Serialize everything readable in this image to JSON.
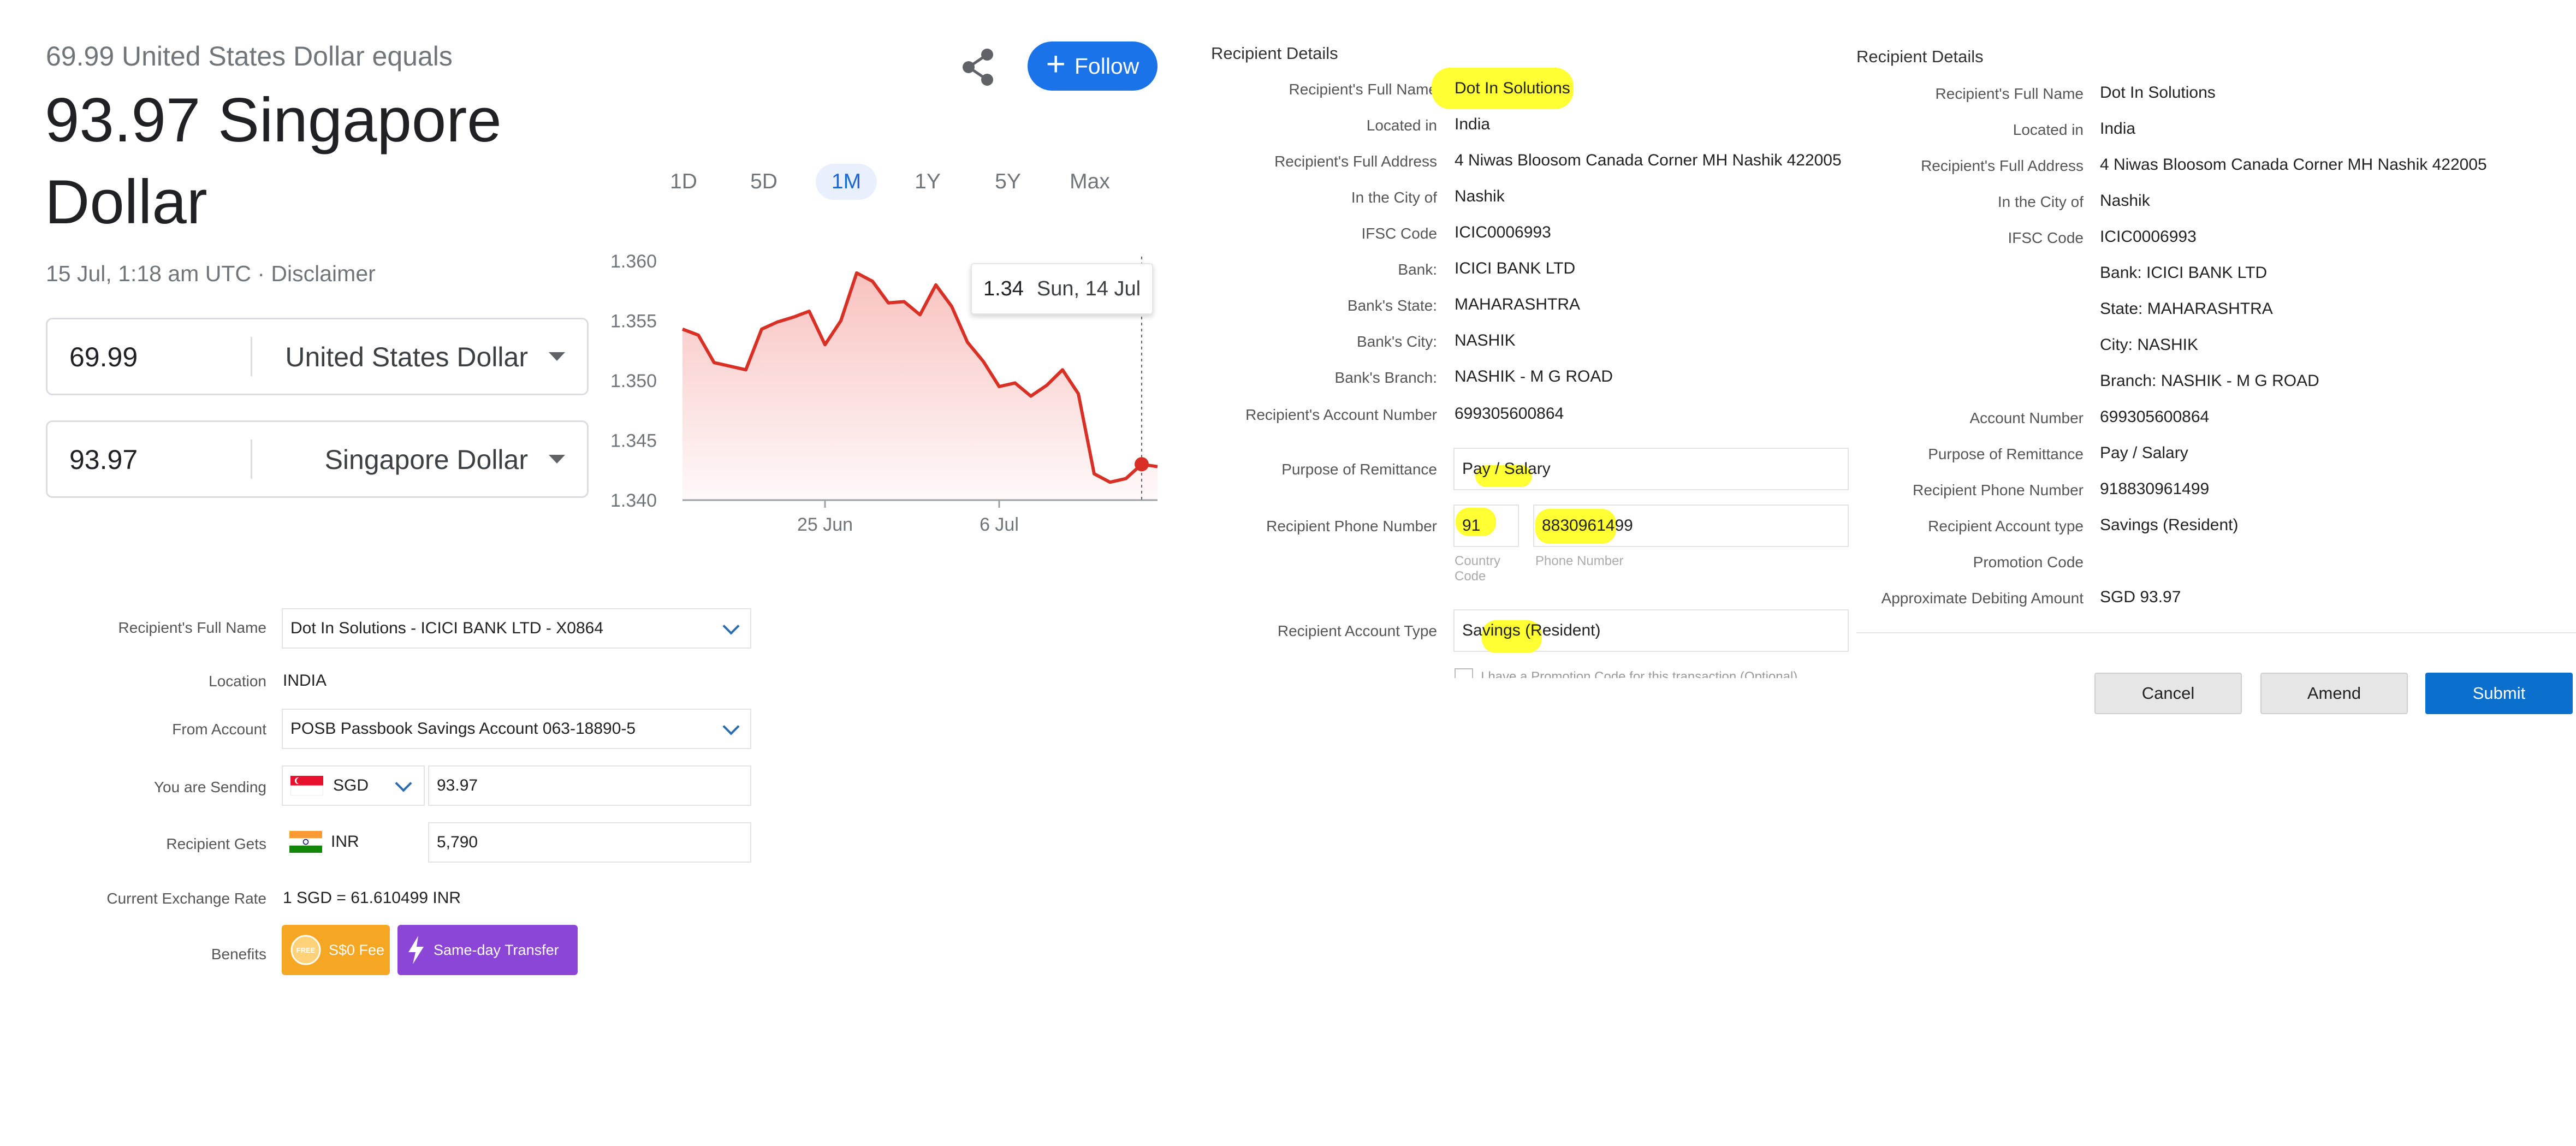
{
  "converter": {
    "equals_text": "69.99 United States Dollar equals",
    "result_line1": "93.97 Singapore",
    "result_line2": "Dollar",
    "timestamp": "15 Jul, 1:18 am UTC · Disclaimer",
    "from_amount": "69.99",
    "from_currency": "United States Dollar",
    "to_amount": "93.97",
    "to_currency": "Singapore Dollar",
    "follow_label": "Follow",
    "follow_plus": "+",
    "ranges": [
      "1D",
      "5D",
      "1M",
      "1Y",
      "5Y",
      "Max"
    ],
    "active_range": "1M",
    "tooltip_value": "1.34",
    "tooltip_date": "Sun, 14 Jul"
  },
  "chart_data": {
    "type": "area",
    "yticks": [
      "1.360",
      "1.355",
      "1.350",
      "1.345",
      "1.340"
    ],
    "xticks": [
      "25 Jun",
      "6 Jul"
    ],
    "ylim": [
      1.34,
      1.36
    ],
    "values": [
      1.3543,
      1.3538,
      1.3515,
      1.3512,
      1.3509,
      1.3543,
      1.3549,
      1.3553,
      1.3558,
      1.353,
      1.355,
      1.359,
      1.3583,
      1.3565,
      1.3566,
      1.3555,
      1.358,
      1.3562,
      1.3532,
      1.3516,
      1.3495,
      1.3498,
      1.3487,
      1.3496,
      1.3509,
      1.3489,
      1.3422,
      1.3415,
      1.3418,
      1.343,
      1.3428
    ],
    "line_color": "#d93025"
  },
  "left_form": {
    "recipient_label": "Recipient's Full Name",
    "recipient_value": "Dot In Solutions - ICICI BANK LTD - X0864",
    "location_label": "Location",
    "location_value": "INDIA",
    "from_account_label": "From Account",
    "from_account_value": "POSB Passbook Savings Account 063-18890-5",
    "sending_label": "You are Sending",
    "sending_currency": "SGD",
    "sending_amount": "93.97",
    "gets_label": "Recipient Gets",
    "gets_currency": "INR",
    "gets_amount": "5,790",
    "rate_label": "Current Exchange Rate",
    "rate_value": "1 SGD = 61.610499 INR",
    "benefits_label": "Benefits",
    "badge_fee": "S$0 Fee",
    "badge_fee_icon_text": "FREE",
    "badge_transfer": "Same-day Transfer",
    "badge_fee_color": "#f5a623",
    "badge_transfer_color": "#8b46d8"
  },
  "middle_form": {
    "header": "Recipient Details",
    "rows": [
      {
        "label": "Recipient's Full Name",
        "value": "Dot In Solutions"
      },
      {
        "label": "Located in",
        "value": "India"
      },
      {
        "label": "Recipient's Full Address",
        "value": "4 Niwas Bloosom Canada Corner MH Nashik 422005"
      },
      {
        "label": "In the City of",
        "value": "Nashik"
      },
      {
        "label": "IFSC Code",
        "value": "ICIC0006993"
      },
      {
        "label": "Bank:",
        "value": "ICICI BANK LTD"
      },
      {
        "label": "Bank's State:",
        "value": "MAHARASHTRA"
      },
      {
        "label": "Bank's City:",
        "value": "NASHIK"
      },
      {
        "label": "Bank's Branch:",
        "value": "NASHIK - M G ROAD"
      },
      {
        "label": "Recipient's Account Number",
        "value": "699305600864"
      }
    ],
    "purpose_label": "Purpose of Remittance",
    "purpose_value": "Pay / Salary",
    "phone_label": "Recipient Phone Number",
    "phone_country": "91",
    "phone_number": "8830961499",
    "country_code_caption_1": "Country",
    "country_code_caption_2": "Code",
    "phone_caption": "Phone Number",
    "account_type_label": "Recipient Account Type",
    "account_type_value": "Savings (Resident)",
    "promo_text": "I have a Promotion Code for this transaction (Optional)"
  },
  "right_form": {
    "header": "Recipient Details",
    "rows": [
      {
        "label": "Recipient's Full Name",
        "value": "Dot In Solutions"
      },
      {
        "label": "Located in",
        "value": "India"
      },
      {
        "label": "Recipient's Full Address",
        "value": "4 Niwas Bloosom Canada Corner MH Nashik 422005"
      },
      {
        "label": "In the City of",
        "value": "Nashik"
      },
      {
        "label": "IFSC Code",
        "value": "ICIC0006993"
      },
      {
        "label": "",
        "value": "Bank: ICICI BANK LTD"
      },
      {
        "label": "",
        "value": "State: MAHARASHTRA"
      },
      {
        "label": "",
        "value": "City: NASHIK"
      },
      {
        "label": "",
        "value": "Branch: NASHIK - M G ROAD"
      },
      {
        "label": "Account Number",
        "value": "699305600864"
      },
      {
        "label": "Purpose of Remittance",
        "value": "Pay / Salary"
      },
      {
        "label": "Recipient Phone Number",
        "value": "918830961499"
      },
      {
        "label": "Recipient Account type",
        "value": "Savings (Resident)"
      },
      {
        "label": "Promotion Code",
        "value": ""
      },
      {
        "label": "Approximate Debiting Amount",
        "value": "SGD 93.97"
      }
    ],
    "cancel_label": "Cancel",
    "amend_label": "Amend",
    "submit_label": "Submit",
    "submit_color": "#0b6fce"
  }
}
